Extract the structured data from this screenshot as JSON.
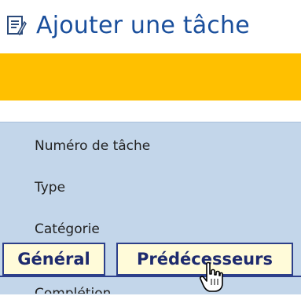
{
  "header": {
    "title": "Ajouter une tâche",
    "icon": "notepad-icon"
  },
  "banner": {
    "color": "#ffc000"
  },
  "form": {
    "fields": [
      {
        "label": "Numéro de tâche"
      },
      {
        "label": "Type"
      },
      {
        "label": "Catégorie"
      }
    ],
    "partial_label": "Complétion"
  },
  "tabs": [
    {
      "label": "Général",
      "active": false
    },
    {
      "label": "Prédécesseurs",
      "active": false
    }
  ],
  "cursor": {
    "icon": "hand-pointer-icon"
  },
  "colors": {
    "title": "#1a4f9c",
    "panel": "#c3d6ea",
    "tab_bg": "#fffbd9",
    "tab_border": "#2d3f8a"
  }
}
